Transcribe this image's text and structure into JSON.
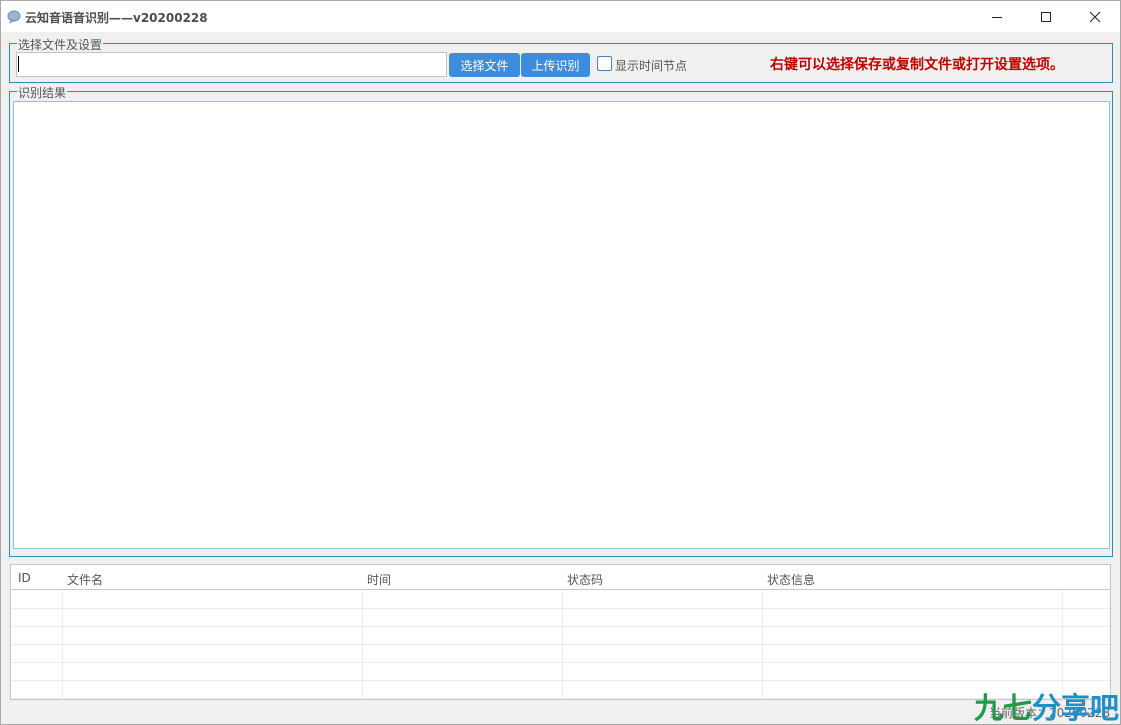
{
  "window": {
    "title": "云知音语音识别——v20200228",
    "icons": {
      "app": "bubble-icon",
      "minimize": "minimize-icon",
      "maximize": "maximize-icon",
      "close": "close-icon"
    }
  },
  "settings_group": {
    "legend": "选择文件及设置",
    "file_path_value": "",
    "choose_button": "选择文件",
    "upload_button": "上传识别",
    "show_timestamps_label": "显示时间节点",
    "show_timestamps_checked": false,
    "hint": "右键可以选择保存或复制文件或打开设置选项。"
  },
  "result_group": {
    "legend": "识别结果",
    "text": ""
  },
  "table": {
    "columns": [
      "ID",
      "文件名",
      "时间",
      "状态码",
      "状态信息"
    ],
    "rows": []
  },
  "status_bar": {
    "version_text": "当前版本：20200228"
  },
  "colors": {
    "accent": "#3c8dde",
    "group_border": "#2b8fb1",
    "hint": "#c00000"
  }
}
